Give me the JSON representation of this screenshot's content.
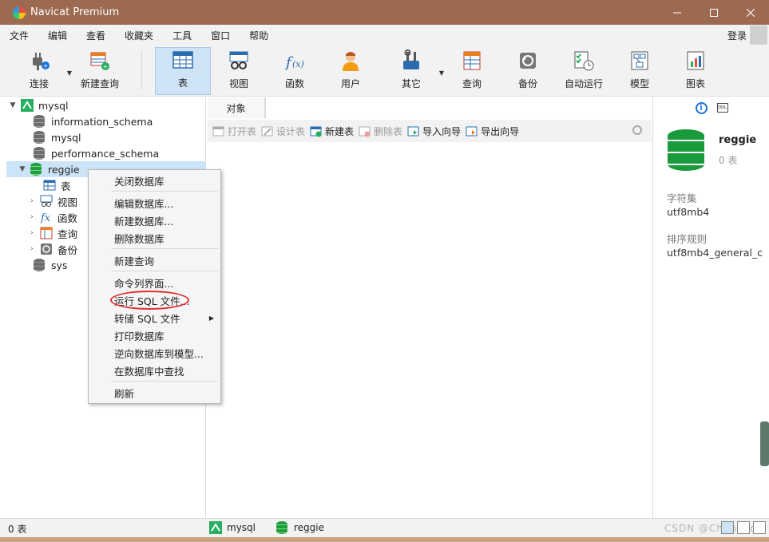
{
  "window": {
    "title": "Navicat Premium"
  },
  "menu": [
    "文件",
    "编辑",
    "查看",
    "收藏夹",
    "工具",
    "窗口",
    "帮助"
  ],
  "login": "登录",
  "toolbar": {
    "connect": "连接",
    "new_query": "新建查询",
    "table": "表",
    "view": "视图",
    "function": "函数",
    "user": "用户",
    "other": "其它",
    "query": "查询",
    "backup": "备份",
    "auto_run": "自动运行",
    "model": "模型",
    "chart": "图表"
  },
  "tree": {
    "connection": "mysql",
    "databases": [
      "information_schema",
      "mysql",
      "performance_schema",
      "reggie",
      "sys"
    ],
    "children": [
      "表",
      "视图",
      "函数",
      "查询",
      "备份"
    ]
  },
  "tabs": {
    "objects": "对象"
  },
  "objbar": {
    "open_table": "打开表",
    "design_table": "设计表",
    "new_table": "新建表",
    "delete_table": "删除表",
    "import_wizard": "导入向导",
    "export_wizard": "导出向导"
  },
  "context_menu": {
    "close_db": "关闭数据库",
    "edit_db": "编辑数据库...",
    "new_db": "新建数据库...",
    "delete_db": "删除数据库",
    "new_query": "新建查询",
    "cmd_console": "命令列界面...",
    "run_sql": "运行 SQL 文件...",
    "dump_sql": "转储 SQL 文件",
    "print_db": "打印数据库",
    "reverse_model": "逆向数据库到模型...",
    "find_in_db": "在数据库中查找",
    "refresh": "刷新"
  },
  "right_panel": {
    "db_name": "reggie",
    "table_count": "0 表",
    "charset_label": "字符集",
    "charset": "utf8mb4",
    "collation_label": "排序规则",
    "collation": "utf8mb4_general_c"
  },
  "status": {
    "count": "0 表",
    "connection": "mysql",
    "database": "reggie",
    "watermark": "CSDN @Chen Mon"
  }
}
